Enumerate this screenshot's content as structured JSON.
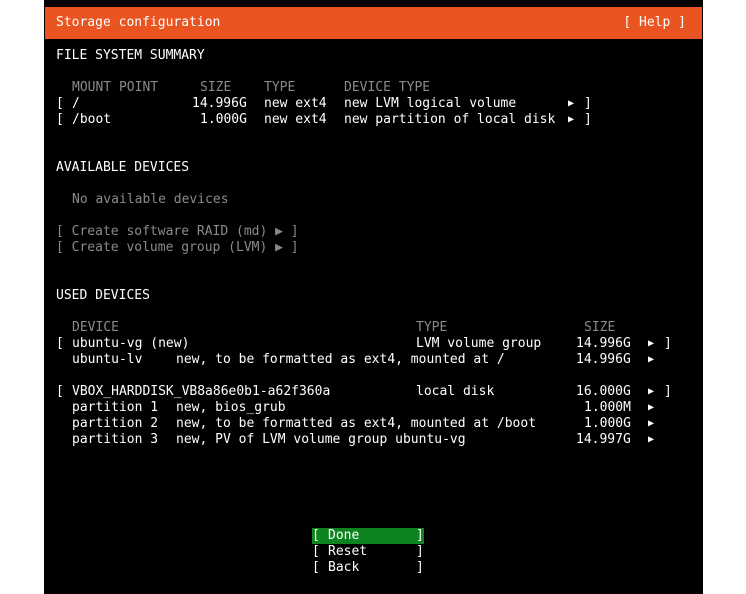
{
  "header": {
    "title": "Storage configuration",
    "help": "[ Help ]",
    "accent": "#e95420"
  },
  "fs_summary": {
    "heading": "FILE SYSTEM SUMMARY",
    "columns": [
      "MOUNT POINT",
      "SIZE",
      "TYPE",
      "DEVICE TYPE"
    ],
    "rows": [
      {
        "open": "[",
        "mount": "/",
        "size": "14.996G",
        "type": "new ext4",
        "device_type": "new LVM logical volume",
        "arrow": "▶",
        "close": "]"
      },
      {
        "open": "[",
        "mount": "/boot",
        "size": "1.000G",
        "type": "new ext4",
        "device_type": "new partition of local disk",
        "arrow": "▶",
        "close": "]"
      }
    ]
  },
  "available": {
    "heading": "AVAILABLE DEVICES",
    "empty": "No available devices",
    "actions": [
      "[ Create software RAID (md) ▶ ]",
      "[ Create volume group (LVM) ▶ ]"
    ]
  },
  "used": {
    "heading": "USED DEVICES",
    "columns": [
      "DEVICE",
      "TYPE",
      "SIZE"
    ],
    "groups": [
      {
        "device": "ubuntu-vg (new)",
        "type": "LVM volume group",
        "size": "14.996G",
        "arrow": "▶",
        "children": [
          {
            "name": "ubuntu-lv",
            "desc": "new, to be formatted as ext4, mounted at /",
            "size": "14.996G",
            "arrow": "▶"
          }
        ]
      },
      {
        "device": "VBOX_HARDDISK_VB8a86e0b1-a62f360a",
        "type": "local disk",
        "size": "16.000G",
        "arrow": "▶",
        "children": [
          {
            "name": "partition 1",
            "desc": "new, bios_grub",
            "size": "1.000M",
            "arrow": "▶"
          },
          {
            "name": "partition 2",
            "desc": "new, to be formatted as ext4, mounted at /boot",
            "size": "1.000G",
            "arrow": "▶"
          },
          {
            "name": "partition 3",
            "desc": "new, PV of LVM volume group ubuntu-vg",
            "size": "14.997G",
            "arrow": "▶"
          }
        ]
      }
    ]
  },
  "buttons": {
    "done": "Done",
    "reset": "Reset",
    "back": "Back",
    "selected_color": "#0e8420"
  }
}
